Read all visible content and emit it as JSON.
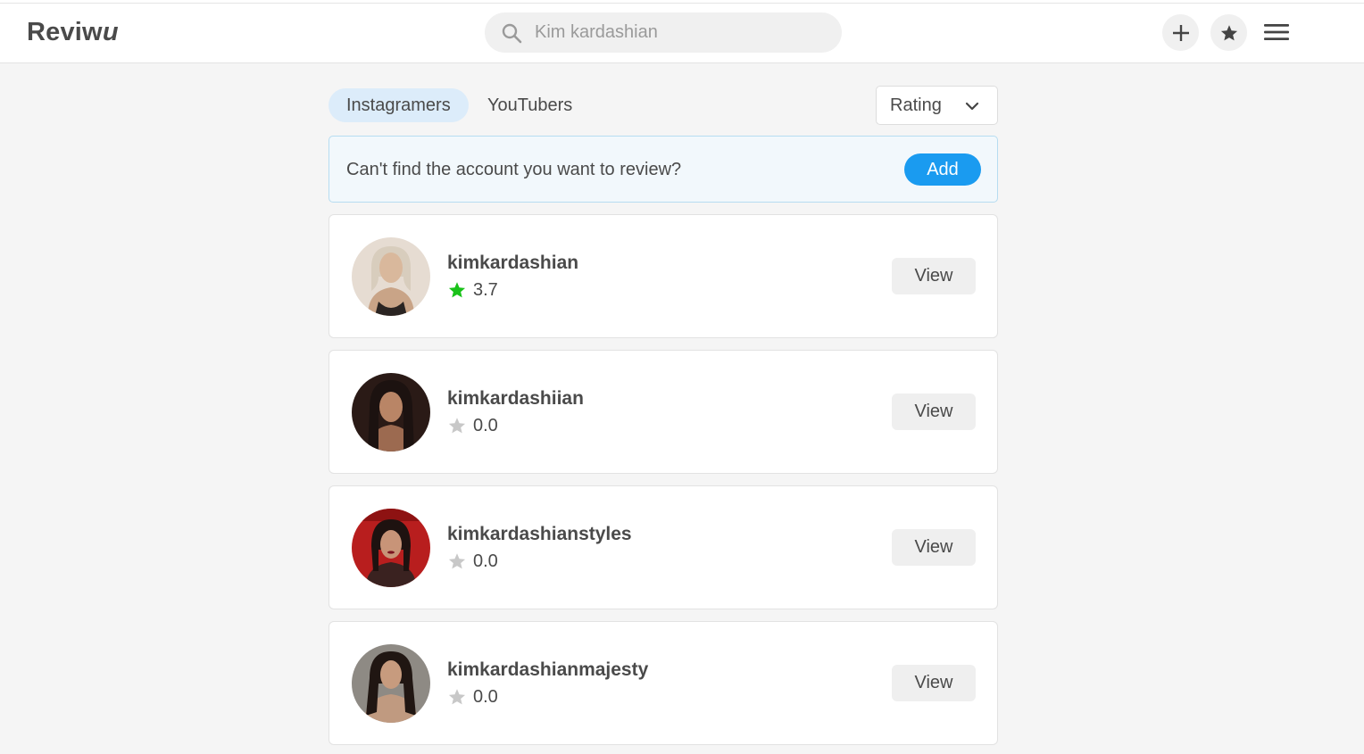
{
  "header": {
    "logo_main": "Reviw",
    "logo_italic": "u",
    "search_placeholder": "Kim kardashian",
    "icons": [
      "search-icon",
      "plus-icon",
      "star-icon",
      "hamburger-menu-icon"
    ]
  },
  "tabs": [
    {
      "label": "Instagramers",
      "active": true
    },
    {
      "label": "YouTubers",
      "active": false
    }
  ],
  "sort": {
    "selected": "Rating"
  },
  "banner": {
    "message": "Can't find the account you want to review?",
    "button_label": "Add"
  },
  "accounts": [
    {
      "username": "kimkardashian",
      "rating": "3.7",
      "rated": true,
      "view_label": "View"
    },
    {
      "username": "kimkardashiian",
      "rating": "0.0",
      "rated": false,
      "view_label": "View"
    },
    {
      "username": "kimkardashianstyles",
      "rating": "0.0",
      "rated": false,
      "view_label": "View"
    },
    {
      "username": "kimkardashianmajesty",
      "rating": "0.0",
      "rated": false,
      "view_label": "View"
    }
  ],
  "colors": {
    "accent": "#1a9bf0",
    "tab_active_bg": "#dcecfa",
    "star_rated": "#19c219",
    "star_unrated": "#c8c8c8"
  }
}
